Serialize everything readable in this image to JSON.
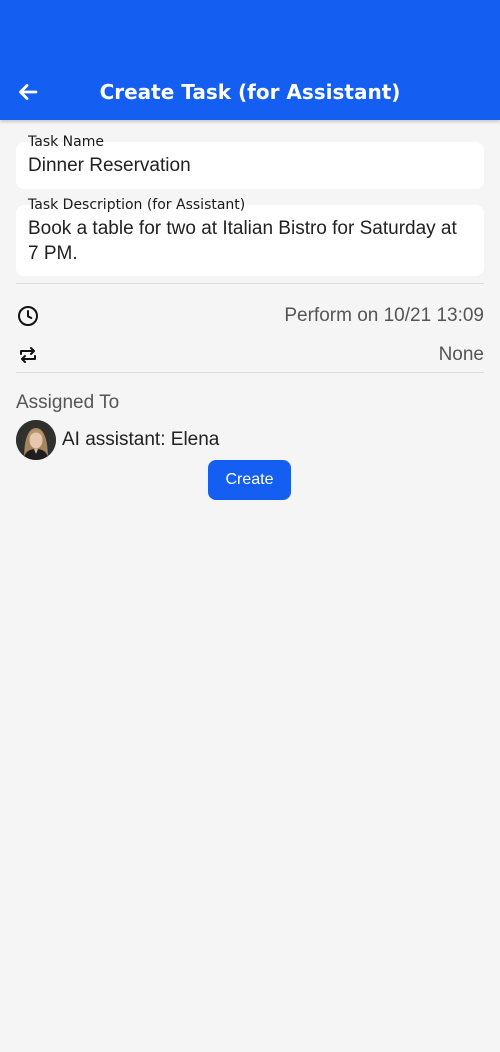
{
  "header": {
    "title": "Create Task (for Assistant)",
    "back_icon": "arrow-left-icon"
  },
  "task_name": {
    "label": "Task Name",
    "value": "Dinner Reservation"
  },
  "task_description": {
    "label": "Task Description (for Assistant)",
    "value": "Book a table for two at Italian Bistro for Saturday at 7 PM."
  },
  "schedule": {
    "icon": "clock-icon",
    "value": "Perform on 10/21 13:09"
  },
  "repeat": {
    "icon": "repeat-icon",
    "value": "None"
  },
  "assigned": {
    "title": "Assigned To",
    "name": "AI assistant: Elena"
  },
  "actions": {
    "create_label": "Create"
  },
  "colors": {
    "primary": "#145ff2",
    "background": "#f5f5f5"
  }
}
